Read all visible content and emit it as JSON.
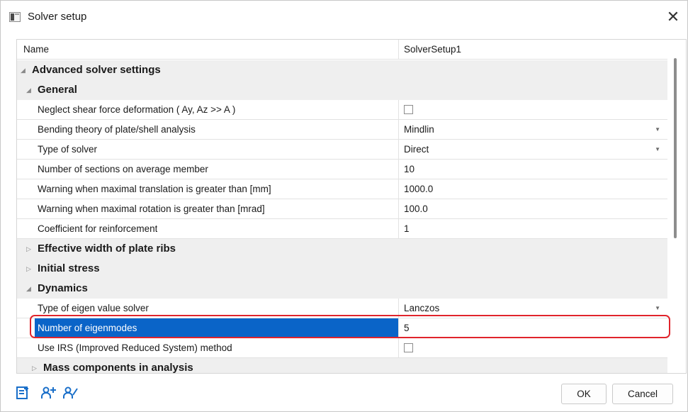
{
  "window": {
    "title": "Solver setup",
    "close_label": "✕"
  },
  "header_row": {
    "name": "Name",
    "value": "SolverSetup1"
  },
  "rows": [
    {
      "label": "Advanced solver settings"
    },
    {
      "label": "General"
    },
    {
      "label": "Neglect shear force deformation ( Ay, Az >> A )",
      "checked": false
    },
    {
      "label": "Bending theory of plate/shell analysis",
      "value": "Mindlin"
    },
    {
      "label": "Type of solver",
      "value": "Direct"
    },
    {
      "label": "Number of sections on average member",
      "value": "10"
    },
    {
      "label": "Warning when maximal translation is greater than [mm]",
      "value": "1000.0"
    },
    {
      "label": "Warning when maximal rotation is greater than [mrad]",
      "value": "100.0"
    },
    {
      "label": "Coefficient for reinforcement",
      "value": "1"
    },
    {
      "label": "Effective width of plate ribs"
    },
    {
      "label": "Initial stress"
    },
    {
      "label": "Dynamics"
    },
    {
      "label": "Type of eigen value solver",
      "value": "Lanczos"
    },
    {
      "label": "Number of eigenmodes",
      "value": "5"
    },
    {
      "label": "Use IRS (Improved Reduced System) method",
      "checked": false
    },
    {
      "label": "Mass components in analysis"
    }
  ],
  "footer": {
    "ok_label": "OK",
    "cancel_label": "Cancel"
  },
  "icons": {
    "footer": [
      "add-document-icon",
      "add-user-icon",
      "user-settings-icon"
    ],
    "accent": "#0a64c8",
    "highlight": "#e0242c"
  }
}
